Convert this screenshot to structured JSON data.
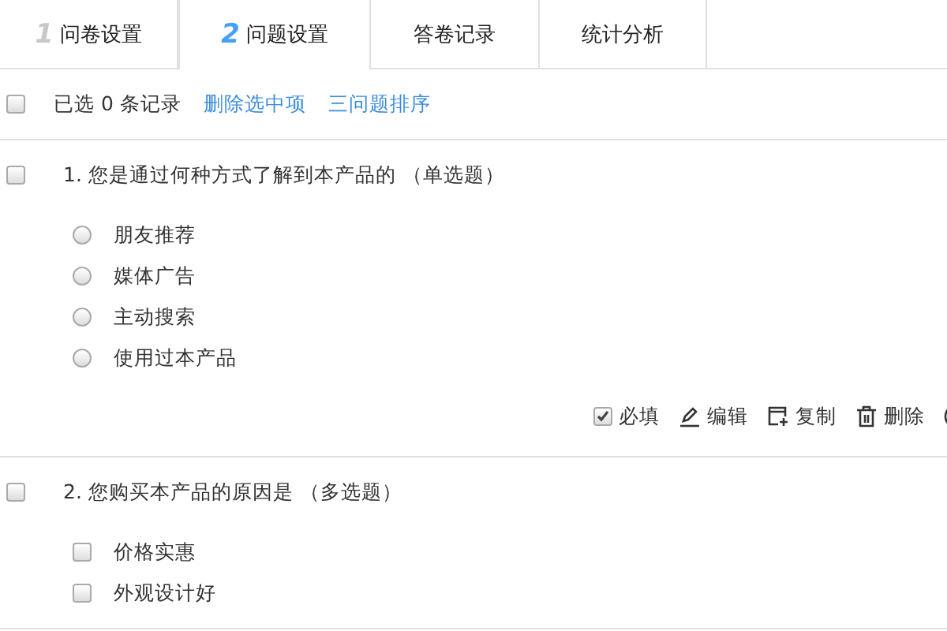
{
  "tabs": [
    {
      "number": "1",
      "label": "问卷设置",
      "selected": false
    },
    {
      "number": "2",
      "label": "问题设置",
      "selected": true
    },
    {
      "label": "答卷记录",
      "selected": false
    },
    {
      "label": "统计分析",
      "selected": false
    }
  ],
  "toolbar": {
    "select_all_checked": false,
    "selected_count": "已选 0 条记录",
    "delete_link": "删除选中项",
    "sort_link": "三问题排序"
  },
  "questions": [
    {
      "kind": "single",
      "checked": false,
      "title": "1. 您是通过何种方式了解到本产品的",
      "type_label": "（单选题）",
      "options": [
        {
          "label": "朋友推荐",
          "selected": false
        },
        {
          "label": "媒体广告",
          "selected": false
        },
        {
          "label": "主动搜索",
          "selected": false
        },
        {
          "label": "使用过本产品",
          "selected": false
        }
      ],
      "actions": {
        "required": {
          "label": "必填",
          "checked": true
        },
        "edit": "编辑",
        "copy": "复制",
        "delete": "删除"
      }
    },
    {
      "kind": "multiple",
      "checked": false,
      "title": "2. 您购买本产品的原因是",
      "type_label": "（多选题）",
      "options": [
        {
          "label": "价格实惠",
          "selected": false
        },
        {
          "label": "外观设计好",
          "selected": false
        }
      ]
    }
  ]
}
